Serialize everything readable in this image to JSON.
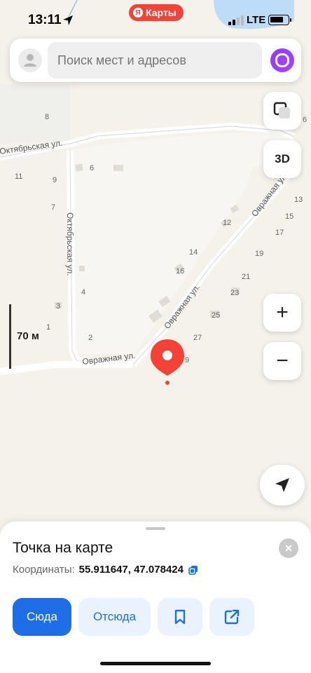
{
  "status_bar": {
    "time": "13:11",
    "network": "LTE",
    "brand_label": "Карты",
    "brand_logo": "Я"
  },
  "search": {
    "placeholder": "Поиск мест и адресов"
  },
  "map": {
    "street_labels": [
      "Октябрьская ул.",
      "Октябрьская ул.",
      "Овражная ул.",
      "Овражная ул.",
      "Овражная ул."
    ],
    "house_numbers": [
      "8",
      "6",
      "11",
      "9",
      "6",
      "7",
      "13",
      "15",
      "12",
      "17",
      "14",
      "19",
      "16",
      "21",
      "4",
      "3",
      "23",
      "25",
      "1",
      "2",
      "27",
      "9"
    ],
    "scale_label": "70 м",
    "btn_3d_label": "3D",
    "zoom_in": "+",
    "zoom_out": "−",
    "pin_color": "#f44336"
  },
  "sheet": {
    "title": "Точка на карте",
    "close": "×",
    "coords_label": "Координаты:",
    "coords_value": "55.911647, 47.078424",
    "actions": {
      "here": "Сюда",
      "from": "Отсюда"
    }
  },
  "colors": {
    "accent": "#1e6ee8",
    "accent_light": "#eaf2fe",
    "brand": "#f44336",
    "alice": "#9b3cff"
  }
}
